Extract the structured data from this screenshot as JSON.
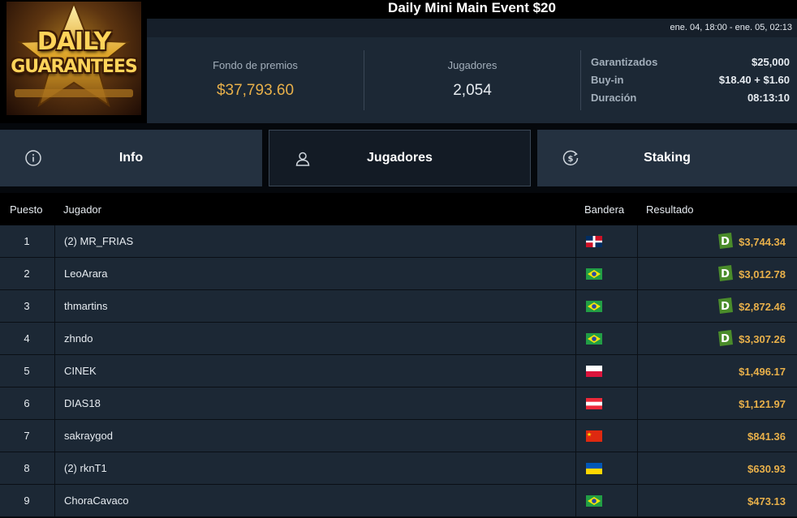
{
  "logo": {
    "line1": "DAILY",
    "line2": "GUARANTEES"
  },
  "header": {
    "title": "Daily Mini Main Event $20",
    "date_range": "ene. 04, 18:00 - ene. 05, 02:13"
  },
  "stats": {
    "prize_label": "Fondo de premios",
    "prize_value": "$37,793.60",
    "players_label": "Jugadores",
    "players_value": "2,054",
    "details": [
      {
        "key": "Garantizados",
        "value": "$25,000"
      },
      {
        "key": "Buy-in",
        "value": "$18.40 + $1.60"
      },
      {
        "key": "Duración",
        "value": "08:13:10"
      }
    ]
  },
  "tabs": [
    {
      "label": "Info",
      "icon": "info-icon"
    },
    {
      "label": "Jugadores",
      "icon": "user-icon"
    },
    {
      "label": "Staking",
      "icon": "dollar-coin-icon"
    }
  ],
  "table": {
    "headers": {
      "pos": "Puesto",
      "player": "Jugador",
      "flag": "Bandera",
      "result": "Resultado"
    },
    "rows": [
      {
        "pos": "1",
        "player": "(2) MR_FRIAS",
        "flag": "DO",
        "result": "$3,744.34",
        "badge": true
      },
      {
        "pos": "2",
        "player": "LeoArara",
        "flag": "BR",
        "result": "$3,012.78",
        "badge": true
      },
      {
        "pos": "3",
        "player": "thmartins",
        "flag": "BR",
        "result": "$2,872.46",
        "badge": true
      },
      {
        "pos": "4",
        "player": "zhndo",
        "flag": "BR",
        "result": "$3,307.26",
        "badge": true
      },
      {
        "pos": "5",
        "player": "CINEK",
        "flag": "PL",
        "result": "$1,496.17",
        "badge": false
      },
      {
        "pos": "6",
        "player": "DIAS18",
        "flag": "AT",
        "result": "$1,121.97",
        "badge": false
      },
      {
        "pos": "7",
        "player": "sakraygod",
        "flag": "CN",
        "result": "$841.36",
        "badge": false
      },
      {
        "pos": "8",
        "player": "(2) rknT1",
        "flag": "UA",
        "result": "$630.93",
        "badge": false
      },
      {
        "pos": "9",
        "player": "ChoraCavaco",
        "flag": "BR",
        "result": "$473.13",
        "badge": false
      }
    ]
  },
  "colors": {
    "accent_gold": "#e8b04a",
    "panel": "#1c2835",
    "tab": "#243140",
    "badge_green": "#4a8c2a"
  }
}
